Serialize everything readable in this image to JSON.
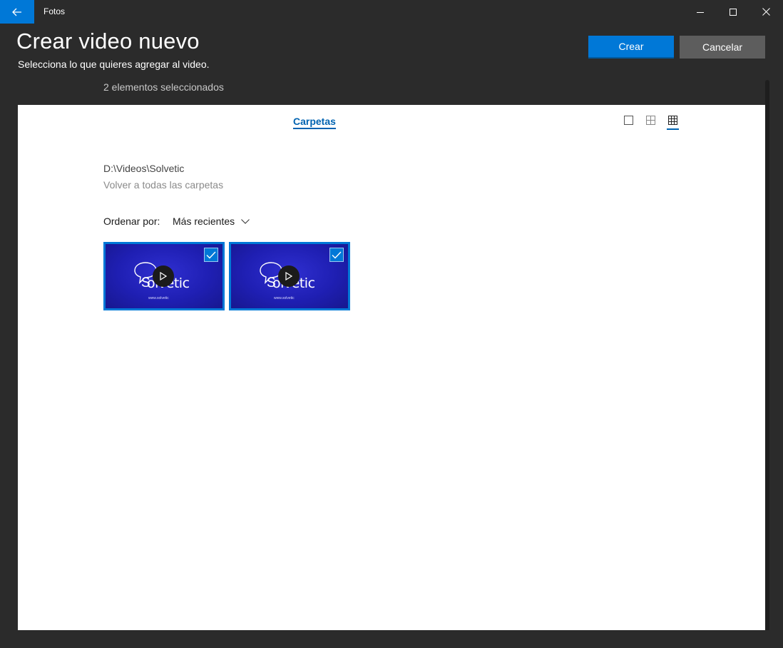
{
  "titlebar": {
    "app_name": "Fotos",
    "icons": {
      "back": "arrow-left-icon",
      "minimize": "minimize-icon",
      "maximize": "maximize-icon",
      "close": "close-icon"
    }
  },
  "header": {
    "title": "Crear video nuevo",
    "subtitle": "Selecciona lo que quieres agregar al video.",
    "selected_count": "2 elementos seleccionados",
    "create_label": "Crear",
    "cancel_label": "Cancelar"
  },
  "content": {
    "tab_label": "Carpetas",
    "view_modes": [
      "large-view-icon",
      "medium-view-icon",
      "small-view-icon"
    ],
    "active_view": "small-view-icon",
    "folder_path": "D:\\Videos\\Solvetic",
    "back_link": "Volver a todas las carpetas",
    "sort_label": "Ordenar por:",
    "sort_value": "Más recientes"
  },
  "videos": [
    {
      "brand": "olvetic",
      "brand_prefix": "S",
      "site": "www.solvetic",
      "selected": true
    },
    {
      "brand": "olvetic",
      "brand_prefix": "S",
      "site": "www.solvetic",
      "selected": true
    }
  ],
  "colors": {
    "accent": "#0078d7",
    "link": "#0063b1",
    "background": "#2b2b2b",
    "panel": "#ffffff"
  }
}
